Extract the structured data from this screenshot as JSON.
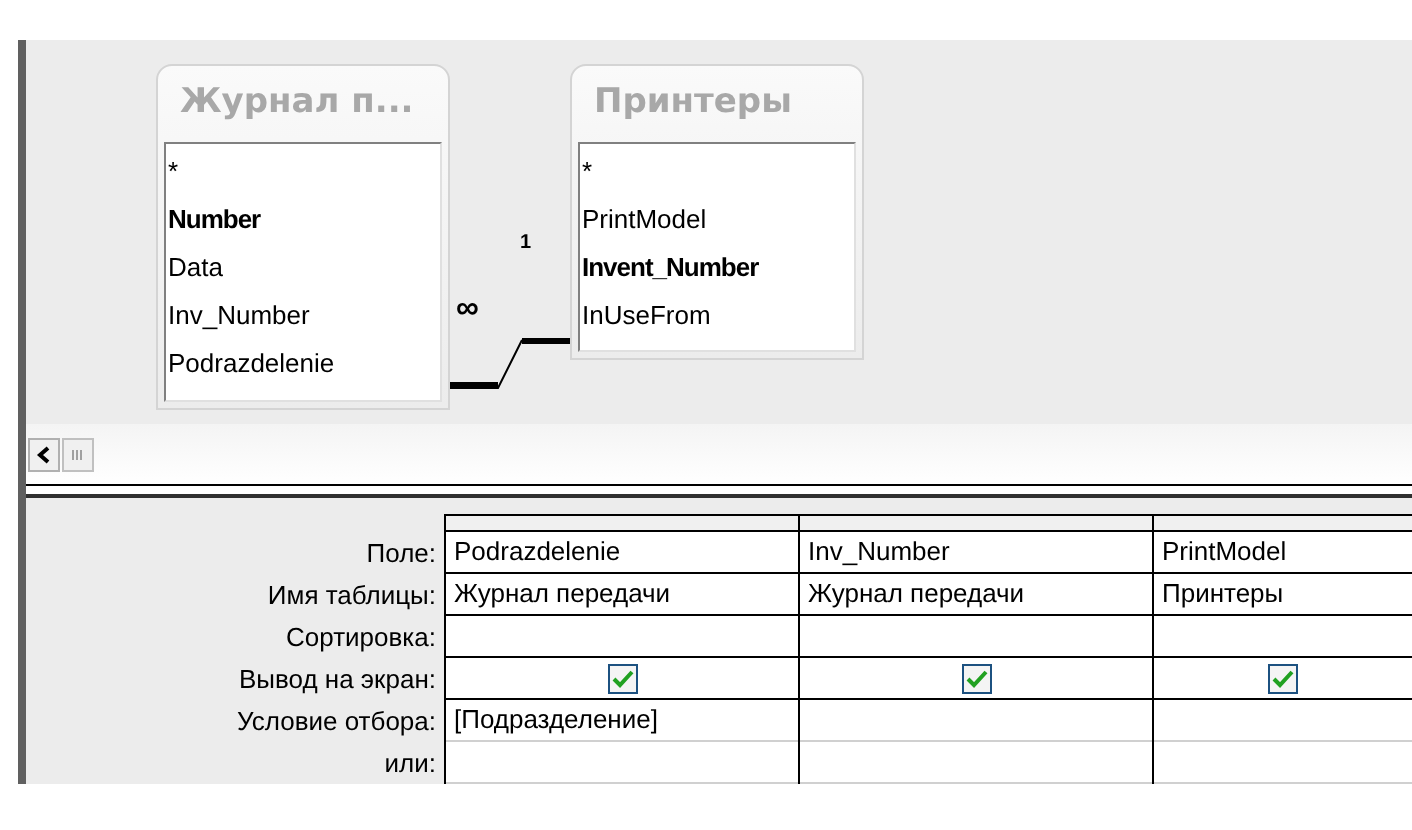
{
  "tables": [
    {
      "title": "Журнал п...",
      "fields": [
        {
          "name": "*",
          "key": false
        },
        {
          "name": "Number",
          "key": true
        },
        {
          "name": "Data",
          "key": false
        },
        {
          "name": "Inv_Number",
          "key": false
        },
        {
          "name": "Podrazdelenie",
          "key": false
        }
      ]
    },
    {
      "title": "Принтеры",
      "fields": [
        {
          "name": "*",
          "key": false
        },
        {
          "name": "PrintModel",
          "key": false
        },
        {
          "name": "Invent_Number",
          "key": true
        },
        {
          "name": "InUseFrom",
          "key": false
        }
      ]
    }
  ],
  "relationship": {
    "many_label": "∞",
    "one_label": "1"
  },
  "grid": {
    "rows": [
      {
        "label": "Поле:",
        "kind": "text",
        "cells": [
          "Podrazdelenie",
          "Inv_Number",
          "PrintModel"
        ]
      },
      {
        "label": "Имя таблицы:",
        "kind": "text",
        "cells": [
          "Журнал передачи",
          "Журнал передачи",
          "Принтеры"
        ]
      },
      {
        "label": "Сортировка:",
        "kind": "text",
        "cells": [
          "",
          "",
          ""
        ]
      },
      {
        "label": "Вывод на экран:",
        "kind": "checkbox",
        "checked": [
          true,
          true,
          true
        ]
      },
      {
        "label": "Условие отбора:",
        "kind": "text",
        "cells": [
          "[Подразделение]",
          "",
          ""
        ]
      },
      {
        "label": "или:",
        "kind": "text",
        "cells": [
          "",
          "",
          ""
        ]
      }
    ]
  }
}
